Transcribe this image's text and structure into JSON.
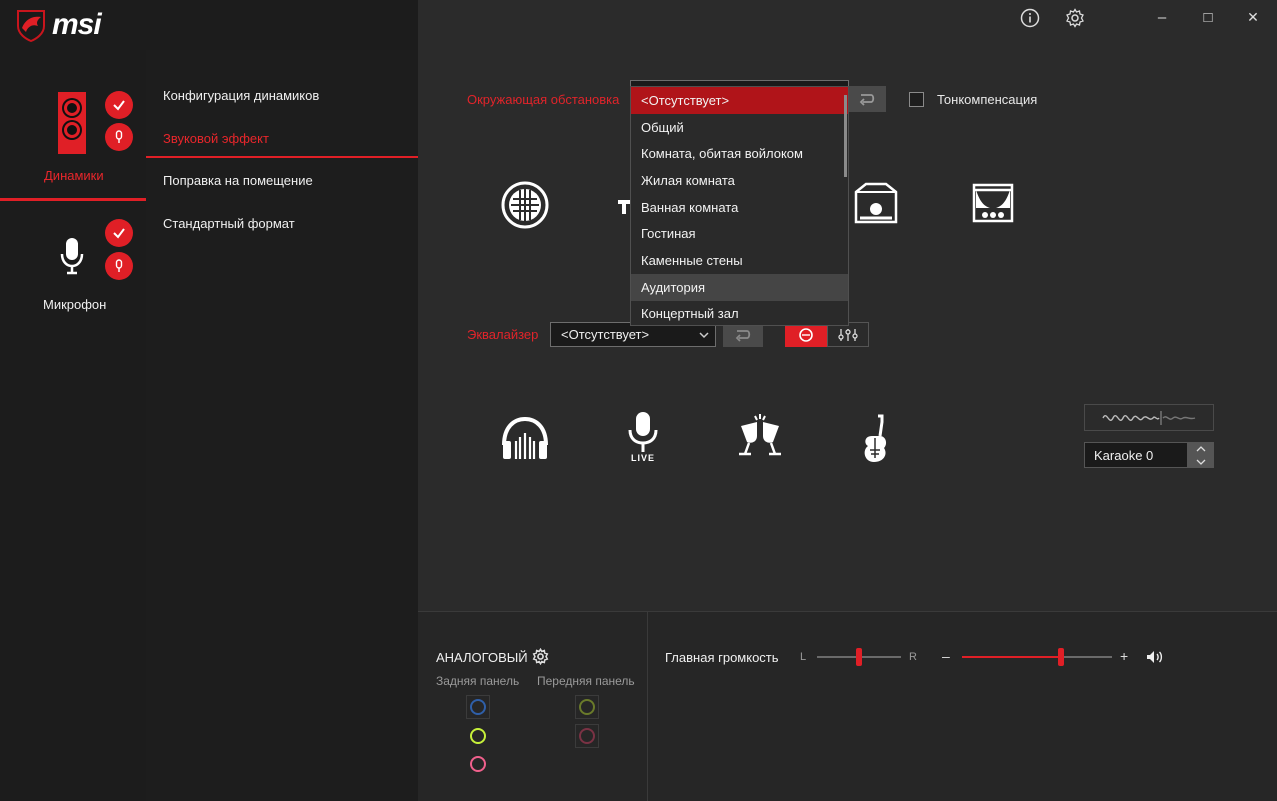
{
  "brand": {
    "logo_text": "msi"
  },
  "titlebar": {
    "info_icon": "info-icon",
    "settings_icon": "gear-icon",
    "minimize": "–",
    "maximize": "□",
    "close": "✕"
  },
  "devices": [
    {
      "label": "Динамики",
      "active": true
    },
    {
      "label": "Микрофон",
      "active": false
    }
  ],
  "menu": {
    "items": [
      {
        "label": "Конфигурация динамиков"
      },
      {
        "label": "Звуковой эффект"
      },
      {
        "label": "Поправка на помещение"
      },
      {
        "label": "Стандартный формат"
      }
    ],
    "selected_index": 1
  },
  "environment": {
    "label": "Окружающая обстановка",
    "selected": "<Отсутствует>",
    "options": [
      "<Отсутствует>",
      "Общий",
      "Комната, обитая войлоком",
      "Жилая комната",
      "Ванная комната",
      "Гостиная",
      "Каменные стены",
      "Аудитория",
      "Концертный зал"
    ],
    "hover_index": 7,
    "loudness_label": "Тонкомпенсация",
    "loudness_checked": false
  },
  "equalizer": {
    "label": "Эквалайзер",
    "selected": "<Отсутствует>",
    "live_badge": "LIVE"
  },
  "karaoke": {
    "value": "Karaoke 0"
  },
  "analog": {
    "title": "АНАЛОГОВЫЙ",
    "rear_label": "Задняя панель",
    "front_label": "Передняя панель"
  },
  "volume": {
    "label": "Главная громкость",
    "balance_left": "L",
    "balance_right": "R",
    "minus": "–",
    "plus": "+",
    "balance_value": 0.5,
    "volume_value": 0.66
  },
  "colors": {
    "accent": "#e8262b",
    "port_blue": "#2f5fa8",
    "port_green": "#c6f03a",
    "port_pink": "#f0608c"
  }
}
